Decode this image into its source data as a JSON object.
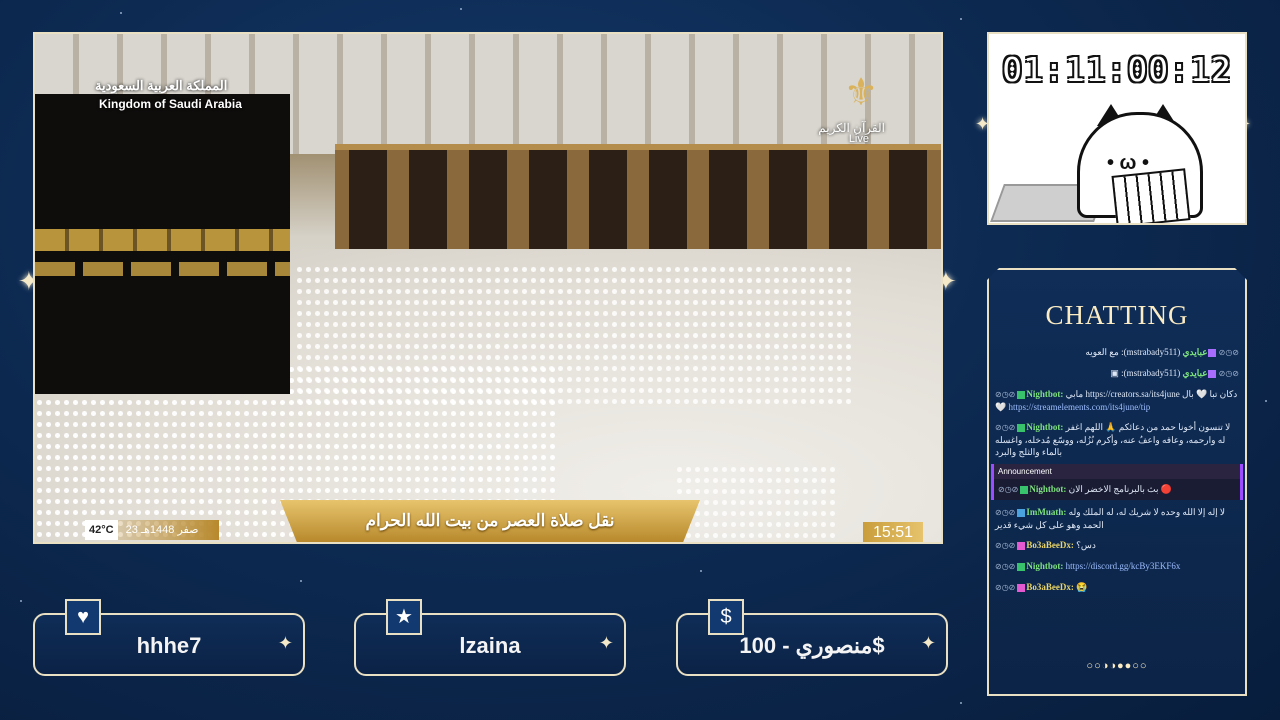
{
  "video": {
    "logo_arabic": "المملكة العربية السعودية",
    "logo_english": "Kingdom of Saudi Arabia",
    "channel_arabic": "القرآن الكريم",
    "channel_live": "Live",
    "ticker": "نقل صلاة العصر من بيت الله الحرام",
    "temperature": "42°C",
    "hijri_date": "23 صفر 1448هـ",
    "clock": "15:51"
  },
  "timer": {
    "value": "01:11:00:12"
  },
  "chat": {
    "title": "CHATTING",
    "messages": [
      {
        "user": "عبايدي",
        "handle": "(mstrabady511):",
        "text": "مع العويه"
      },
      {
        "user": "عبايدي",
        "handle": "(mstrabady511):",
        "text": ""
      },
      {
        "user": "Nightbot:",
        "text": "مابي https://creators.sa/its4june دكان تبا 🤍 بال 🤍",
        "link": "https://streamelements.com/its4june/tip"
      },
      {
        "user": "Nightbot:",
        "text": "لا تنسون أخونا حمد من دعائكم 🙏 اللهم اغفر له وارحمه، وعافه واعفُ عنه، وأكرم نُزُله، ووسّع مُدخله، واغسله بالماء والثلج والبرد"
      },
      {
        "user": "Nightbot:",
        "text": "بث بالبرنامج الاخضر الان 🔴",
        "announcement": "Announcement"
      },
      {
        "user": "ImMuath:",
        "text": "لا إله إلا الله وحده لا شريك له، له الملك وله الحمد وهو على كل شيء قدير"
      },
      {
        "user": "Bo3aBeeDx:",
        "text": "دس؟"
      },
      {
        "user": "Nightbot:",
        "text": "https://discord.gg/kcBy3EKF6x"
      },
      {
        "user": "Bo3aBeeDx:",
        "text": "😭"
      }
    ],
    "pager": "○○◑◑●●○○"
  },
  "donations": [
    {
      "icon": "heart-icon",
      "glyph": "♥",
      "name": "hhhe7"
    },
    {
      "icon": "star-icon",
      "glyph": "★",
      "name": "lzaina"
    },
    {
      "icon": "dollar-icon",
      "glyph": "$",
      "name": "منصوري - 100$"
    }
  ]
}
